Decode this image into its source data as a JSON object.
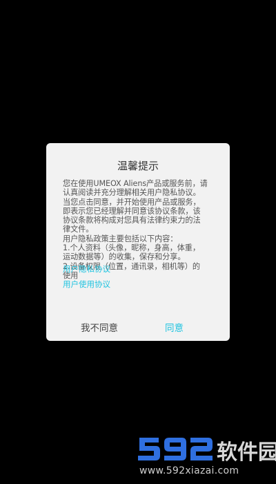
{
  "dialog": {
    "title": "温馨提示",
    "body_lines": [
      "您在使用UMEOX Aliens产品或服务前，请",
      "认真阅读并充分理解相关用户隐私协议。",
      "当您点击同意，并开始使用产品或服务，",
      "即表示您已经理解并同意该协议条款，该",
      "协议条款将构成对您具有法律约束力的法",
      "律文件。",
      "用户隐私政策主要包括以下内容：",
      "1.个人资料（头像，昵称，身高，体重，",
      "运动数据等）的收集，保存和分享。",
      "2.设备权限（位置，通讯录，相机等）的",
      "使用"
    ],
    "links": {
      "privacy_policy": "用户隐私协议",
      "terms_of_use": "用户使用协议"
    },
    "buttons": {
      "decline": "我不同意",
      "agree": "同意"
    }
  },
  "watermark": {
    "brand": "592软件园",
    "url": "www.592xiazai.com"
  },
  "colors": {
    "background": "#000000",
    "dialog_bg": "#f2f2f2",
    "accent": "#22c4e0",
    "watermark_blue": "#2f6fe0"
  }
}
